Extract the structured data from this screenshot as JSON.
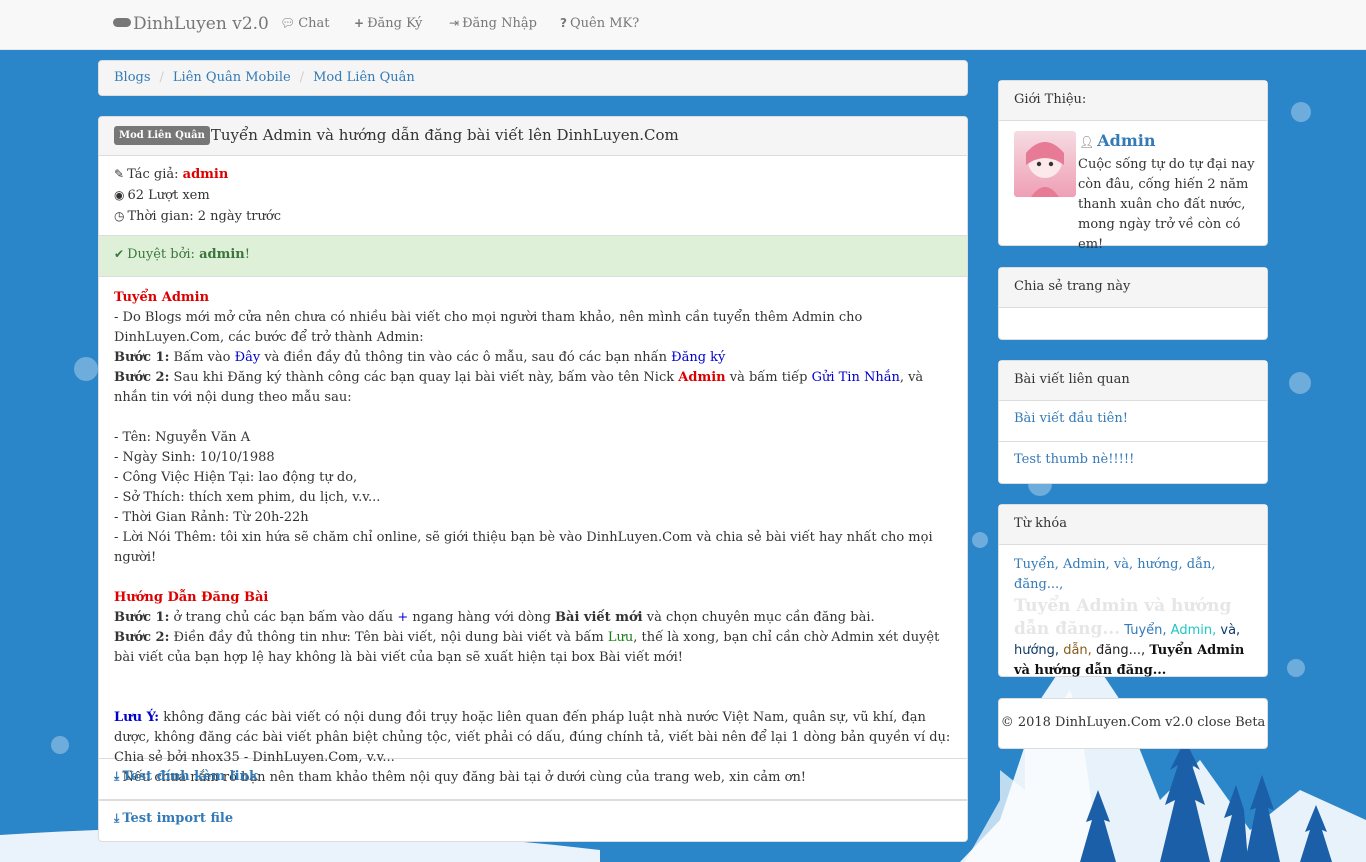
{
  "navbar": {
    "brand": "DinhLuyen v2.0",
    "items": [
      {
        "icon": "chat-icon",
        "label": "Chat"
      },
      {
        "icon": "plus-icon",
        "label": "Đăng Ký"
      },
      {
        "icon": "sign-in-icon",
        "label": "Đăng Nhập"
      },
      {
        "icon": "question-icon",
        "label": "Quên MK?"
      }
    ]
  },
  "breadcrumb": [
    "Blogs",
    "Liên Quân Mobile",
    "Mod Liên Quân"
  ],
  "post": {
    "label": "Mod Liên Quân",
    "title": "Tuyển Admin và hướng dẫn đăng bài viết lên DinhLuyen.Com",
    "author_prefix": "Tác giả:",
    "author": "admin",
    "views": "62 Lượt xem",
    "time": "Thời gian: 2 ngày trước",
    "approved_prefix": "Duyệt bởi:",
    "approved_by": "admin",
    "approved_suffix": "!",
    "recruit_heading": "Tuyển Admin",
    "intro": "- Do Blogs mới mở cửa nên chưa có nhiều bài viết cho mọi người tham khảo, nên mình cần tuyển thêm Admin cho DinhLuyen.Com, các bước để trở thành Admin:",
    "s1_label": "Bước 1:",
    "s1_a": "Bấm vào",
    "s1_link": "Đây",
    "s1_b": "và điền đầy đủ thông tin vào các ô mẫu, sau đó các bạn nhấn",
    "s1_link2": "Đăng ký",
    "s2_label": "Bước 2:",
    "s2_a": "Sau khi Đăng ký thành công các bạn quay lại bài viết này, bấm vào tên Nick",
    "s2_nick": "Admin",
    "s2_b": "và bấm tiếp",
    "s2_link": "Gửi Tin Nhắn",
    "s2_c": ", và nhắn tin với nội dung theo mẫu sau:",
    "form_lines": [
      "- Tên: Nguyễn Văn A",
      "- Ngày Sinh: 10/10/1988",
      "- Công Việc Hiện Tại: lao động tự do,",
      "- Sở Thích: thích xem phim, du lịch, v.v...",
      "- Thời Gian Rảnh: Từ 20h-22h",
      "- Lời Nói Thêm: tôi xin hứa sẽ chăm chỉ online, sẽ giới thiệu bạn bè vào DinhLuyen.Com và chia sẻ bài viết hay nhất cho mọi người!"
    ],
    "guide_heading": "Hướng Dẫn Đăng Bài",
    "g1_label": "Bước 1:",
    "g1_a": "ở trang chủ các bạn bấm vào dấu",
    "g1_plus": "+",
    "g1_b": "ngang hàng với dòng",
    "g1_bold": "Bài viết mới",
    "g1_c": "và chọn chuyên mục cần đăng bài.",
    "g2_label": "Bước 2:",
    "g2_a": "Điền đầy đủ thông tin như: Tên bài viết, nội dung bài viết và bấm",
    "g2_save": "Lưu",
    "g2_b": ", thế là xong, bạn chỉ cần chờ Admin xét duyệt bài viết của bạn hợp lệ hay không là bài viết của bạn sẽ xuất hiện tại box Bài viết mới!",
    "note_label": "Lưu Ý:",
    "note_text": "không đăng các bài viết có nội dung đồi trụy hoặc liên quan đến pháp luật nhà nước Việt Nam, quân sự, vũ khí, đạn dược, không đăng các bài viết phân biệt chủng tộc, viết phải có dấu, đúng chính tả, viết bài nên để lại 1 dòng bản quyền ví dụ: Chia sẻ bởi nhox35 - DinhLuyen.Com, v.v...",
    "note_line2": "- Nếu chưa nắm rõ bạn nên tham khảo thêm nội quy đăng bài tại ở dưới cùng của trang web, xin cảm ơn!",
    "attachments": [
      "Test đính kèm link",
      "Test import file"
    ]
  },
  "sidebar": {
    "intro_title": "Giới Thiệu:",
    "admin_name": "Admin",
    "admin_bio": "Cuộc sống tự do tự đại nay còn đâu, cống hiến 2 năm thanh xuân cho đất nước, mong ngày trở về còn có em!",
    "share_title": "Chia sẻ trang này",
    "related_title": "Bài viết liên quan",
    "related": [
      "Bài viết đầu tiên!",
      "Test thumb nè!!!!!"
    ],
    "tags_title": "Từ khóa",
    "tags_line1": "Tuyển, Admin, và, hướng, dẫn, đăng...,",
    "tags_big": "Tuyển Admin và hướng dẫn đăng...",
    "tags_t1": "Tuyển,",
    "tags_t2": "Admin,",
    "tags_t3": "và,",
    "tags_t4": "hướng,",
    "tags_t5": "dẫn,",
    "tags_t6": "đăng...,",
    "tags_bold": "Tuyển Admin và hướng dẫn đăng...",
    "footer": "© 2018 DinhLuyen.Com v2.0 close Beta"
  },
  "colors": {
    "accent": "#337ab7",
    "bg": "#1e7bc4",
    "success_bg": "#dff0d8"
  }
}
